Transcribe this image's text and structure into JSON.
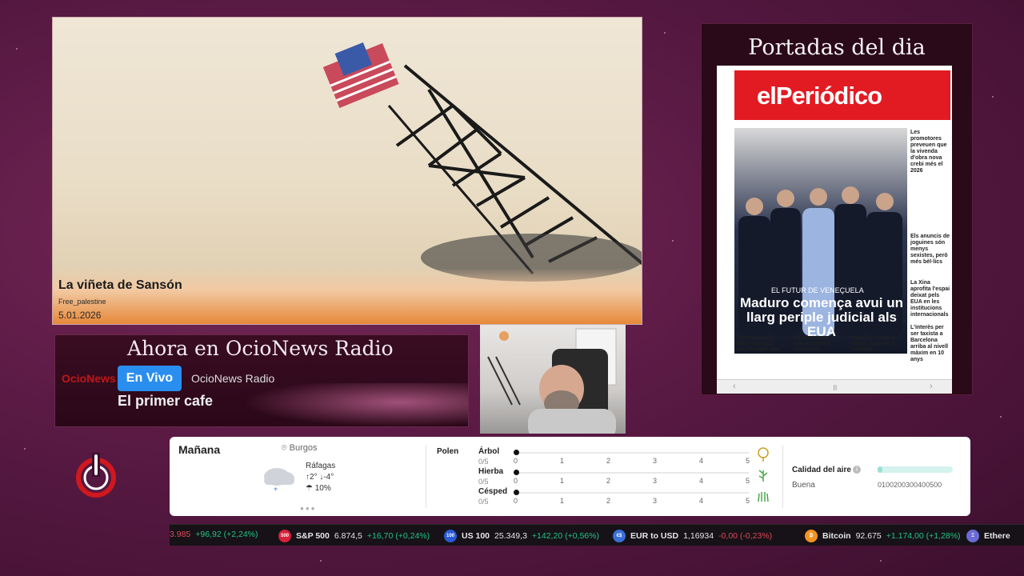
{
  "cartoon": {
    "title": "La viñeta de Sansón",
    "author": "Free_palestine",
    "date": "5.01.2026"
  },
  "radio": {
    "heading": "Ahora en OcioNews Radio",
    "logo_text": "OcioNews",
    "live_label": "En Vivo",
    "station": "OcioNews Radio",
    "program": "El primer cafe"
  },
  "portadas": {
    "heading": "Portadas del dia",
    "masthead": "elPeriódico",
    "kicker": "EL FUTUR DE VENEÇUELA",
    "headline": "Maduro comença avui un llarg periple judicial als EUA",
    "side_stories": [
      "Les promotores preveuen que la vivenda d'obra nova crebi més el 2026",
      "Els anuncis de joguines són menys sexistes, però més bèl·lics",
      "La Xina aprofita l'espai deixat pels EUA en les institucions internacionals",
      "L'interès per ser taxista a Barcelona arriba al nivell màxim en 10 anys"
    ],
    "bottom_stories": [
      "Trump amenaça Delcy Rodríguez amb un segon atac",
      "Els demòcrates s'alcen contra la intervenció",
      "Espanya, Colòmbia i Mèxic, junts per la sobirania"
    ]
  },
  "weather": {
    "day": "Mañana",
    "location": "Burgos",
    "gusts_label": "Ráfagas",
    "temp_high": "2°",
    "temp_low": "-4°",
    "rain_chance": "10%",
    "pollen_label": "Polen",
    "pollen": [
      {
        "name": "Árbol",
        "score": "0/5"
      },
      {
        "name": "Hierba",
        "score": "0/5"
      },
      {
        "name": "Césped",
        "score": "0/5"
      }
    ],
    "scale": [
      "0",
      "1",
      "2",
      "3",
      "4",
      "5"
    ],
    "air_quality_label": "Calidad del aire",
    "air_quality_status": "Buena",
    "air_quality_scale": "0100200300400500",
    "air_quality_fraction": 0.06
  },
  "ticker": [
    {
      "symbol": "",
      "name": "",
      "price": "3.985",
      "change": "+96,92 (+2,24%)",
      "dir": "up"
    },
    {
      "symbol": "500",
      "name": "S&P 500",
      "price": "6.874,5",
      "change": "+16,70 (+0,24%)",
      "dir": "up",
      "color": "#d6203a"
    },
    {
      "symbol": "100",
      "name": "US 100",
      "price": "25.349,3",
      "change": "+142,20 (+0,56%)",
      "dir": "up",
      "color": "#2a5bd7"
    },
    {
      "symbol": "€$",
      "name": "EUR to USD",
      "price": "1,16934",
      "change": "-0,00 (-0,23%)",
      "dir": "down",
      "color": "#3a6fd8"
    },
    {
      "symbol": "₿",
      "name": "Bitcoin",
      "price": "92.675",
      "change": "+1.174,00 (+1,28%)",
      "dir": "up",
      "color": "#f39321"
    },
    {
      "symbol": "Ξ",
      "name": "Ethere",
      "price": "",
      "change": "",
      "dir": "up",
      "color": "#6b6bd6"
    }
  ]
}
